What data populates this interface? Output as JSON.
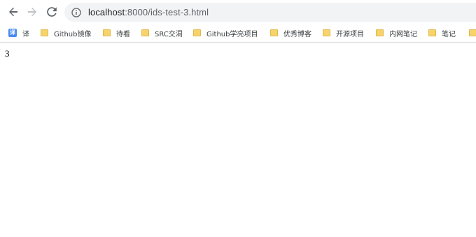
{
  "toolbar": {
    "back_icon": "arrow-left",
    "forward_icon": "arrow-right",
    "reload_icon": "reload"
  },
  "address_bar": {
    "host": "localhost",
    "path": ":8000/ids-test-3.html",
    "info_icon": "info-circle"
  },
  "bookmarks": [
    {
      "label": "译",
      "icon": "translate-icon"
    },
    {
      "label": "Github镜像",
      "icon": "folder-icon"
    },
    {
      "label": "待看",
      "icon": "folder-icon"
    },
    {
      "label": "SRC交洞",
      "icon": "folder-icon"
    },
    {
      "label": "Github学亮项目",
      "icon": "folder-icon"
    },
    {
      "label": "优秀博客",
      "icon": "folder-icon"
    },
    {
      "label": "开源项目",
      "icon": "folder-icon"
    },
    {
      "label": "内网笔记",
      "icon": "folder-icon"
    },
    {
      "label": "笔记",
      "icon": "folder-icon"
    }
  ],
  "page": {
    "body_text": "3"
  }
}
